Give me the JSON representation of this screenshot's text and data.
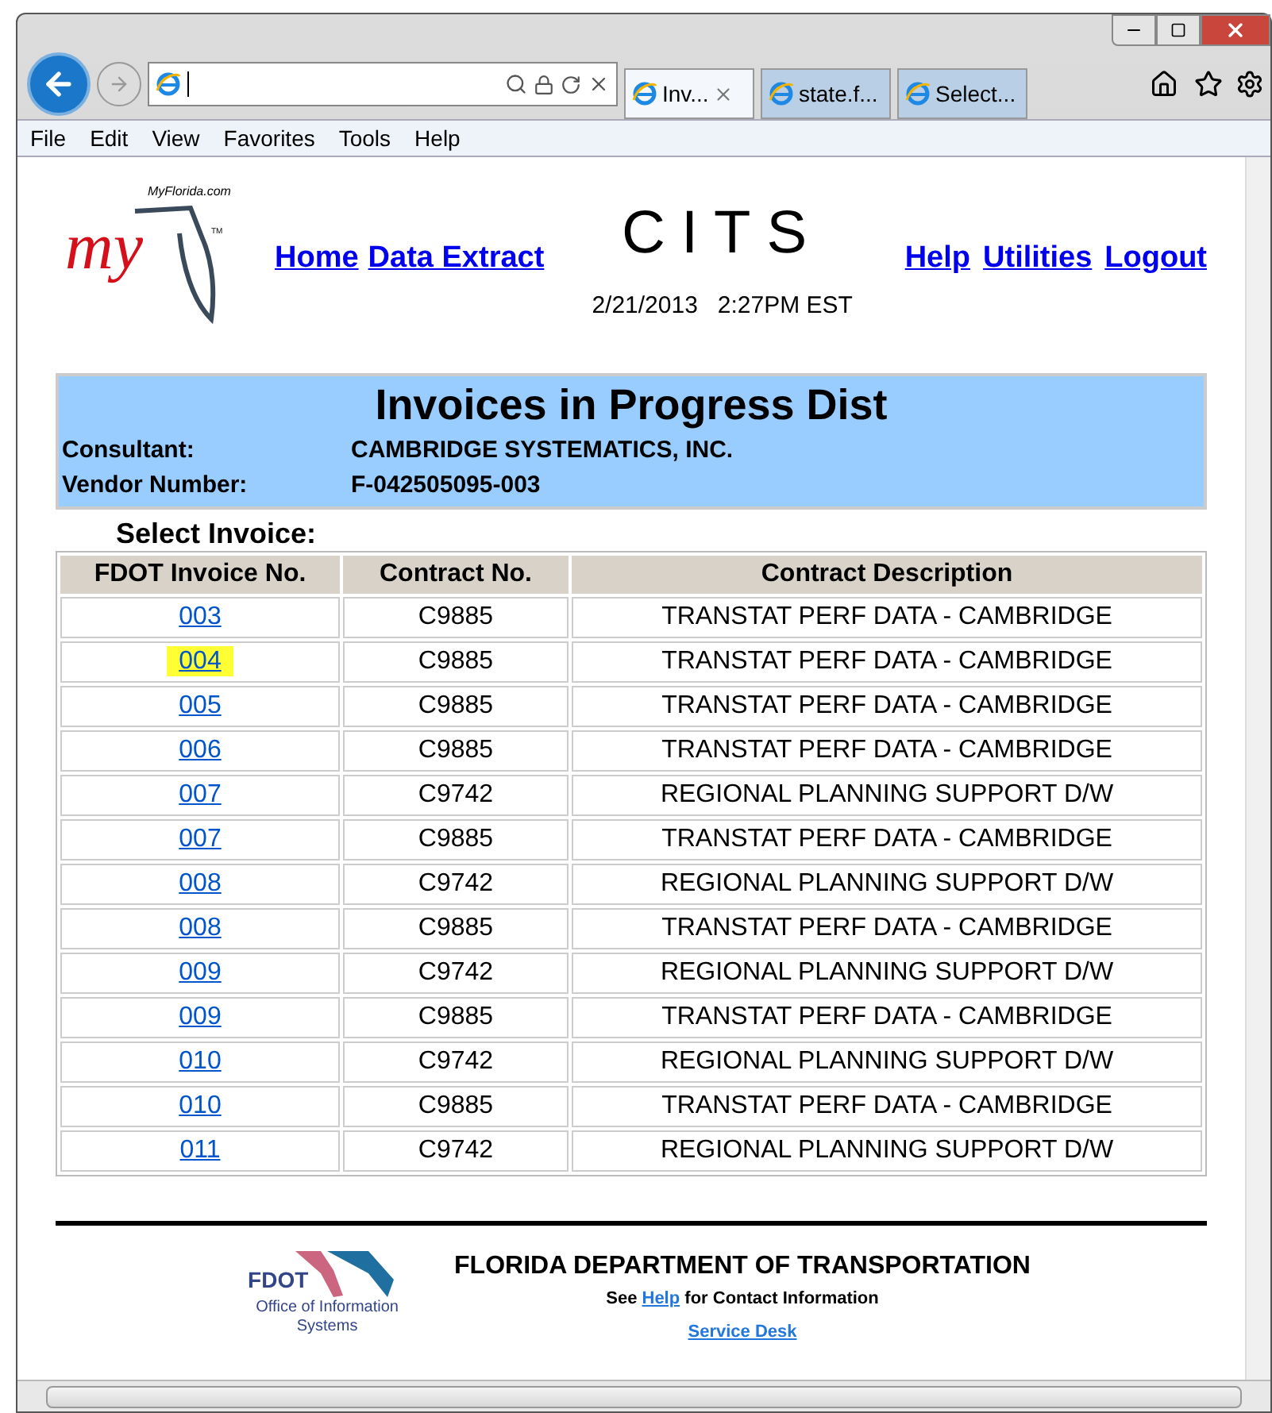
{
  "browser": {
    "tabs": [
      {
        "label": "Inv...",
        "selected": true
      },
      {
        "label": "state.f...",
        "selected": false
      },
      {
        "label": "Select...",
        "selected": false
      }
    ],
    "menu": [
      "File",
      "Edit",
      "View",
      "Favorites",
      "Tools",
      "Help"
    ]
  },
  "header": {
    "logo_site": "MyFlorida.com",
    "logo_word": "my",
    "logo_tm": "TM",
    "left_links": [
      "Home",
      "Data Extract"
    ],
    "app_title": "CITS",
    "date": "2/21/2013",
    "time": "2:27PM EST",
    "right_links": [
      "Help",
      "Utilities",
      "Logout"
    ]
  },
  "info_panel": {
    "title": "Invoices in Progress Dist",
    "fields": [
      {
        "label": "Consultant:",
        "value": "CAMBRIDGE SYSTEMATICS, INC."
      },
      {
        "label": "Vendor Number:",
        "value": "F-042505095-003"
      }
    ]
  },
  "select_label": "Select Invoice:",
  "table": {
    "columns": [
      "FDOT Invoice No.",
      "Contract No.",
      "Contract Description"
    ],
    "rows": [
      {
        "invoice": "003",
        "contract": "C9885",
        "description": "TRANSTAT PERF DATA - CAMBRIDGE",
        "highlighted": false
      },
      {
        "invoice": "004",
        "contract": "C9885",
        "description": "TRANSTAT PERF DATA - CAMBRIDGE",
        "highlighted": true
      },
      {
        "invoice": "005",
        "contract": "C9885",
        "description": "TRANSTAT PERF DATA - CAMBRIDGE",
        "highlighted": false
      },
      {
        "invoice": "006",
        "contract": "C9885",
        "description": "TRANSTAT PERF DATA - CAMBRIDGE",
        "highlighted": false
      },
      {
        "invoice": "007",
        "contract": "C9742",
        "description": "REGIONAL PLANNING SUPPORT D/W",
        "highlighted": false
      },
      {
        "invoice": "007",
        "contract": "C9885",
        "description": "TRANSTAT PERF DATA - CAMBRIDGE",
        "highlighted": false
      },
      {
        "invoice": "008",
        "contract": "C9742",
        "description": "REGIONAL PLANNING SUPPORT D/W",
        "highlighted": false
      },
      {
        "invoice": "008",
        "contract": "C9885",
        "description": "TRANSTAT PERF DATA - CAMBRIDGE",
        "highlighted": false
      },
      {
        "invoice": "009",
        "contract": "C9742",
        "description": "REGIONAL PLANNING SUPPORT D/W",
        "highlighted": false
      },
      {
        "invoice": "009",
        "contract": "C9885",
        "description": "TRANSTAT PERF DATA - CAMBRIDGE",
        "highlighted": false
      },
      {
        "invoice": "010",
        "contract": "C9742",
        "description": "REGIONAL PLANNING SUPPORT D/W",
        "highlighted": false
      },
      {
        "invoice": "010",
        "contract": "C9885",
        "description": "TRANSTAT PERF DATA - CAMBRIDGE",
        "highlighted": false
      },
      {
        "invoice": "011",
        "contract": "C9742",
        "description": "REGIONAL PLANNING SUPPORT D/W",
        "highlighted": false
      }
    ]
  },
  "footer": {
    "logo_name": "FDOT",
    "logo_caption": "Office of Information Systems",
    "title": "FLORIDA DEPARTMENT OF TRANSPORTATION",
    "note_before": "See",
    "note_link": "Help",
    "note_after": "for Contact Information",
    "service_link": "Service Desk"
  }
}
